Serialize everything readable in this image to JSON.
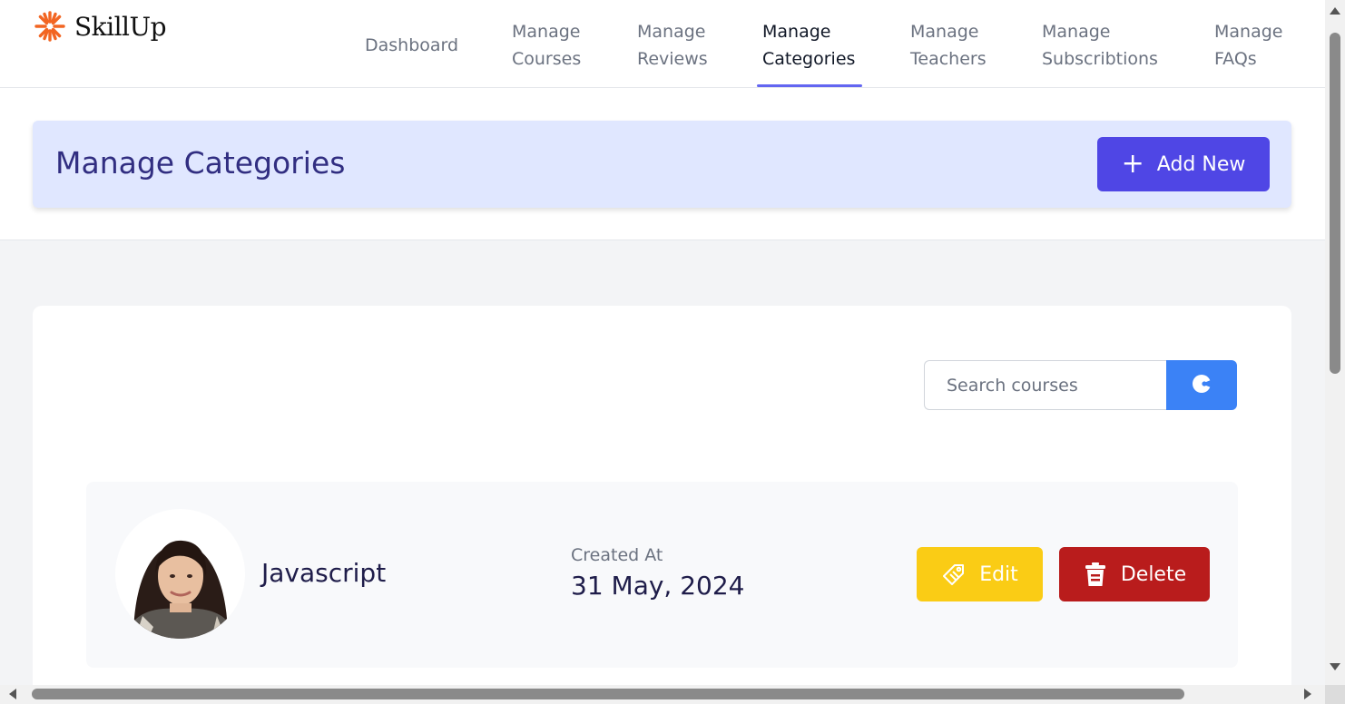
{
  "brand": {
    "name": "SkillUp",
    "icon": "sunburst-logo-icon",
    "icon_color": "#f26522"
  },
  "nav": {
    "items": [
      {
        "line1": "Dashboard",
        "line2": ""
      },
      {
        "line1": "Manage",
        "line2": "Courses"
      },
      {
        "line1": "Manage",
        "line2": "Reviews"
      },
      {
        "line1": "Manage",
        "line2": "Categories"
      },
      {
        "line1": "Manage",
        "line2": "Teachers"
      },
      {
        "line1": "Manage",
        "line2": "Subscribtions"
      },
      {
        "line1": "Manage",
        "line2": "FAQs"
      }
    ],
    "active": "Manage Categories"
  },
  "header": {
    "title": "Manage Categories",
    "add_button_label": "Add New",
    "add_button_icon": "plus-icon"
  },
  "search": {
    "placeholder": "Search courses",
    "value": "",
    "button_icon": "search-icon"
  },
  "categories": [
    {
      "name": "Javascript",
      "created_label": "Created At",
      "created_at": "31 May, 2024",
      "edit_label": "Edit",
      "delete_label": "Delete"
    }
  ],
  "colors": {
    "accent": "#4f46e5",
    "header_bg": "#e0e7ff",
    "title": "#312e81",
    "search_button": "#3b82f6",
    "edit": "#facc15",
    "delete": "#b91c1c",
    "nav_underline": "#6366f1"
  }
}
